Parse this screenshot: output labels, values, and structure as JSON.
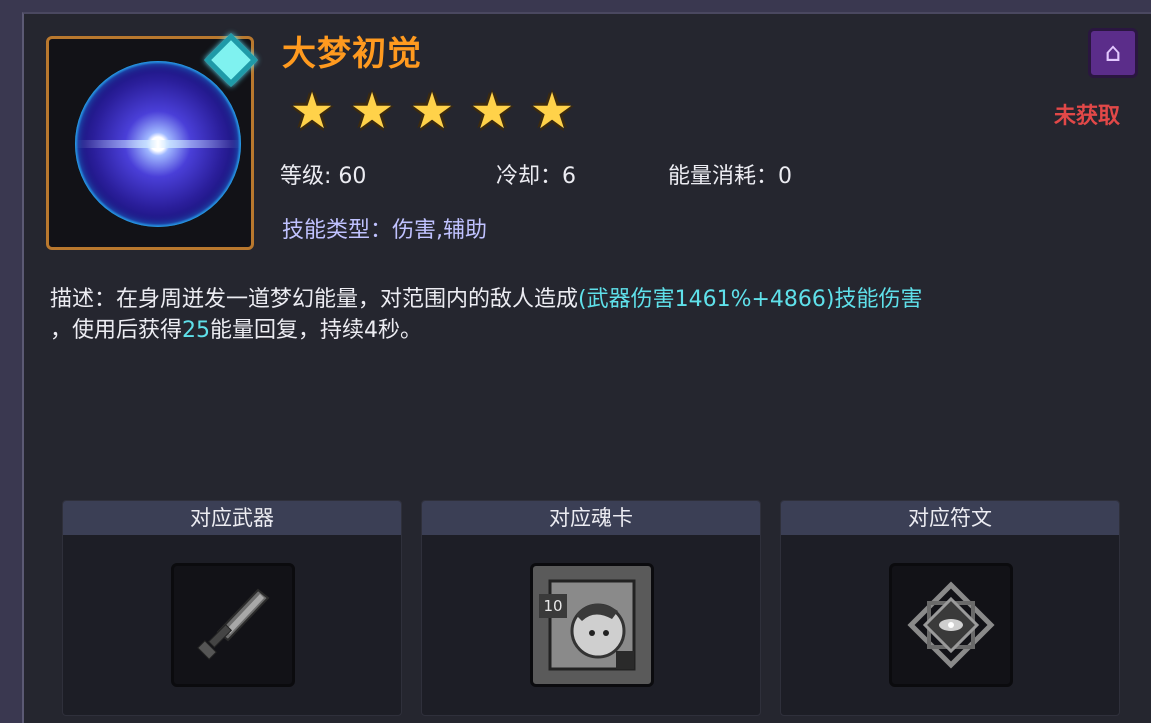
{
  "skill": {
    "name": "大梦初觉",
    "stars": 5,
    "level_label": "等级: 60",
    "cooldown_label": "冷却：6",
    "energy_cost_label": "能量消耗：0",
    "skill_type_label": "技能类型：伤害,辅助",
    "status": "未获取"
  },
  "description": {
    "part1": "描述：在身周迸发一道梦幻能量，对范围内的敌人造成",
    "highlight1": "(武器伤害1461%+4866)技能伤害",
    "part2": "，使用后获得",
    "highlight2": "25",
    "part3": "能量回复，持续4秒。"
  },
  "cards": [
    {
      "title": "对应武器",
      "icon": "dagger-icon"
    },
    {
      "title": "对应魂卡",
      "icon": "soul-card-icon",
      "badge": "10"
    },
    {
      "title": "对应符文",
      "icon": "rune-icon"
    }
  ],
  "colors": {
    "title": "#ff9a1f",
    "highlight": "#5fe0ea",
    "status_red": "#e24848",
    "skill_type": "#c0c2ff"
  }
}
